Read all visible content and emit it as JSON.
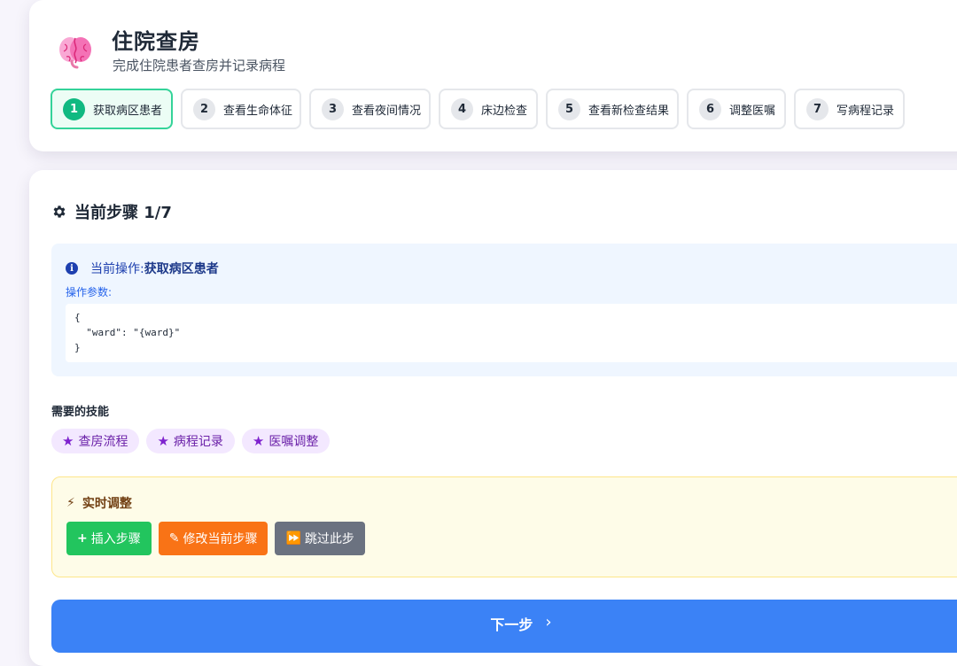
{
  "header": {
    "title": "住院查房",
    "subtitle": "完成住院患者查房并记录病程",
    "icon": "brain-icon"
  },
  "steps": [
    {
      "num": "1",
      "label": "获取病区患者",
      "active": true
    },
    {
      "num": "2",
      "label": "查看生命体征",
      "active": false
    },
    {
      "num": "3",
      "label": "查看夜间情况",
      "active": false
    },
    {
      "num": "4",
      "label": "床边检查",
      "active": false
    },
    {
      "num": "5",
      "label": "查看新检查结果",
      "active": false
    },
    {
      "num": "6",
      "label": "调整医嘱",
      "active": false
    },
    {
      "num": "7",
      "label": "写病程记录",
      "active": false
    }
  ],
  "current": {
    "section_title": "当前步骤 1/7",
    "operation_prefix": "当前操作:",
    "operation_name": "获取病区患者",
    "params_label": "操作参数:",
    "params_code": "{\n  \"ward\": \"{ward}\"\n}"
  },
  "skills": {
    "title": "需要的技能",
    "items": [
      "查房流程",
      "病程记录",
      "医嘱调整"
    ]
  },
  "adjust": {
    "title": "实时调整",
    "insert_label": "插入步骤",
    "modify_label": "修改当前步骤",
    "skip_label": "跳过此步"
  },
  "next": {
    "label": "下一步"
  },
  "colors": {
    "active_step": "#10b981",
    "primary": "#3b82f6",
    "insert": "#22c55e",
    "modify": "#f97316",
    "skip": "#6b7280",
    "skill_bg": "#f3e8ff"
  }
}
